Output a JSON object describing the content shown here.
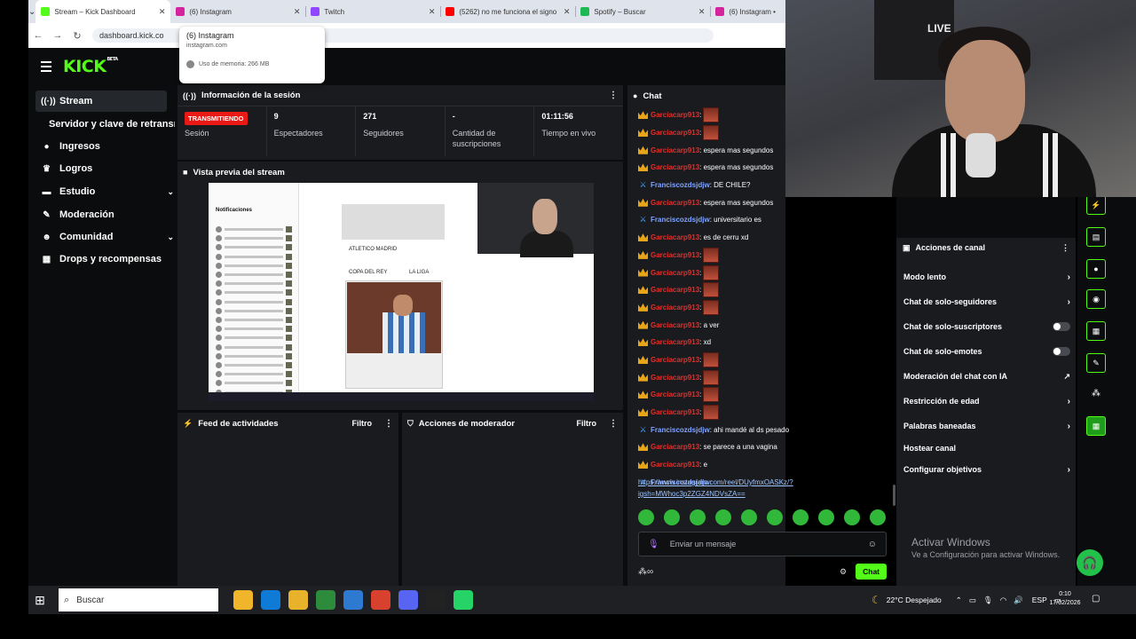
{
  "browser": {
    "tabs": [
      {
        "label": "Stream – Kick Dashboard",
        "active": true,
        "favicon_color": "#53fc18"
      },
      {
        "label": "(6) Instagram",
        "active": false,
        "favicon_color": "#d6249f"
      },
      {
        "label": "Twitch",
        "active": false,
        "favicon_color": "#9146ff"
      },
      {
        "label": "(5262) no me funciona el signo",
        "active": false,
        "favicon_color": "#ff0000"
      },
      {
        "label": "Spotify – Buscar",
        "active": false,
        "favicon_color": "#1db954"
      },
      {
        "label": "(6) Instagram •",
        "active": false,
        "favicon_color": "#d6249f"
      }
    ],
    "url": "dashboard.kick.co",
    "hovercard": {
      "title": "(6) Instagram",
      "domain": "instagram.com",
      "memory": "Uso de memoria: 266 MB"
    }
  },
  "sidebar": {
    "items": [
      {
        "label": "Stream",
        "icon": "signal-icon",
        "glyph": "((·))"
      },
      {
        "label": "Servidor y clave de retransmisión",
        "icon": "",
        "glyph": ""
      },
      {
        "label": "Ingresos",
        "icon": "coins-icon",
        "glyph": "●"
      },
      {
        "label": "Logros",
        "icon": "trophy-icon",
        "glyph": "♛"
      },
      {
        "label": "Estudio",
        "icon": "studio-icon",
        "glyph": "▬"
      },
      {
        "label": "Moderación",
        "icon": "wrench-icon",
        "glyph": "✎"
      },
      {
        "label": "Comunidad",
        "icon": "community-icon",
        "glyph": "☻"
      },
      {
        "label": "Drops y recompensas",
        "icon": "drops-icon",
        "glyph": "▦"
      }
    ]
  },
  "session": {
    "title": "Información de la sesión",
    "status": "TRANSMITIENDO",
    "status_label": "Sesión",
    "stats": [
      {
        "value": "9",
        "label": "Espectadores"
      },
      {
        "value": "271",
        "label": "Seguidores"
      },
      {
        "value": "-",
        "label": "Cantidad de suscripciones"
      },
      {
        "value": "01:11:56",
        "label": "Tiempo en vivo"
      }
    ]
  },
  "preview": {
    "title": "Vista previa del stream",
    "notifications": "Notificaciones",
    "team1": "ATLETICO MADRID",
    "comp1": "COPA DEL REY",
    "comp2": "LA LIGA"
  },
  "activity": {
    "title": "Feed de actividades",
    "filter": "Filtro"
  },
  "modactions": {
    "title": "Acciones de moderador",
    "filter": "Filtro"
  },
  "chat": {
    "title": "Chat",
    "messages": [
      {
        "user": "Garciacarp913",
        "type": "red",
        "text": "",
        "emote": true
      },
      {
        "user": "Garciacarp913",
        "type": "red",
        "text": "",
        "emote": true
      },
      {
        "user": "Garciacarp913",
        "type": "red",
        "text": ": espera mas segundos",
        "emote": false
      },
      {
        "user": "Garciacarp913",
        "type": "red",
        "text": ": espera mas segundos",
        "emote": false
      },
      {
        "user": "Franciscozdsjdjw",
        "type": "blue",
        "text": ": DE CHILE?",
        "emote": false
      },
      {
        "user": "Garciacarp913",
        "type": "red",
        "text": ": espera mas segundos",
        "emote": false
      },
      {
        "user": "Franciscozdsjdjw",
        "type": "blue",
        "text": ": universitario es",
        "emote": false
      },
      {
        "user": "Garciacarp913",
        "type": "red",
        "text": ": es de cerru xd",
        "emote": false
      },
      {
        "user": "Garciacarp913",
        "type": "red",
        "text": "",
        "emote": true
      },
      {
        "user": "Garciacarp913",
        "type": "red",
        "text": "",
        "emote": true
      },
      {
        "user": "Garciacarp913",
        "type": "red",
        "text": "",
        "emote": true
      },
      {
        "user": "Garciacarp913",
        "type": "red",
        "text": "",
        "emote": true
      },
      {
        "user": "Garciacarp913",
        "type": "red",
        "text": ": a ver",
        "emote": false
      },
      {
        "user": "Garciacarp913",
        "type": "red",
        "text": ": xd",
        "emote": false
      },
      {
        "user": "Garciacarp913",
        "type": "red",
        "text": "",
        "emote": true
      },
      {
        "user": "Garciacarp913",
        "type": "red",
        "text": "",
        "emote": true
      },
      {
        "user": "Garciacarp913",
        "type": "red",
        "text": "",
        "emote": true
      },
      {
        "user": "Garciacarp913",
        "type": "red",
        "text": "",
        "emote": true
      },
      {
        "user": "Franciscozdsjdjw",
        "type": "blue",
        "text": ": ahi mandé al ds pesado",
        "emote": false
      },
      {
        "user": "Garciacarp913",
        "type": "red",
        "text": ": se parece a una vagina",
        "emote": false
      },
      {
        "user": "Garciacarp913",
        "type": "red",
        "text": ": e",
        "emote": false
      },
      {
        "user": "Franciscozdsjdjw",
        "type": "blue",
        "text": ":",
        "emote": false
      }
    ],
    "link_line1": "https://www.instagram.com/reel/DUyfmxOASKz/?",
    "link_line2": "igsh=MWhoc3p2ZGZ4NDVsZA==",
    "input_placeholder": "Enviar un mensaje",
    "send_label": "Chat"
  },
  "channel_actions": {
    "title": "Acciones de canal",
    "items": [
      {
        "label": "Modo lento",
        "control": "chevron"
      },
      {
        "label": "Chat de solo-seguidores",
        "control": "chevron"
      },
      {
        "label": "Chat de solo-suscriptores",
        "control": "toggle"
      },
      {
        "label": "Chat de solo-emotes",
        "control": "toggle"
      },
      {
        "label": "Moderación del chat con IA",
        "control": "external"
      },
      {
        "label": "Restricción de edad",
        "control": "chevron"
      },
      {
        "label": "Palabras baneadas",
        "control": "chevron"
      },
      {
        "label": "Hostear canal",
        "control": "none"
      },
      {
        "label": "Configurar objetivos",
        "control": "chevron"
      }
    ]
  },
  "windows_activation": {
    "line1": "Activar Windows",
    "line2": "Ve a Configuración para activar Windows."
  },
  "webcam": {
    "sign": "LIVE"
  },
  "taskbar": {
    "search": "Buscar",
    "weather": "22°C  Despejado",
    "lang": "ESP",
    "time": "0:10",
    "date": "17/02/2026",
    "app_colors": [
      "#f0b52a",
      "#0f7bd6",
      "#e8b22a",
      "#2c8c3c",
      "#2e7ad1",
      "#d9412f",
      "#5865f2",
      "#222222",
      "#25d366"
    ]
  }
}
